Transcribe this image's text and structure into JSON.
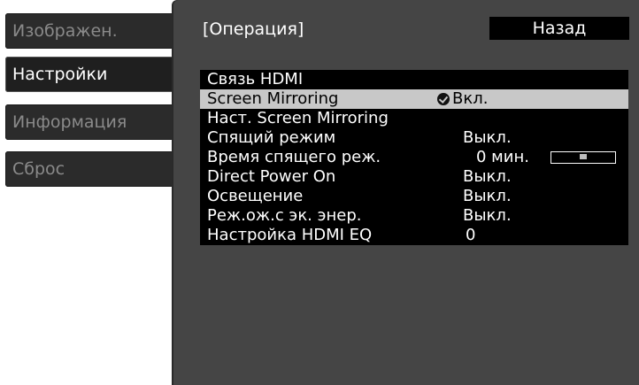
{
  "sidebar": {
    "items": [
      {
        "label": "Изображен."
      },
      {
        "label": "Настройки"
      },
      {
        "label": "Информация"
      },
      {
        "label": "Сброс"
      }
    ]
  },
  "header": {
    "title": "[Операция]",
    "back_label": "Назад"
  },
  "menu": {
    "rows": [
      {
        "label": "Связь HDMI",
        "value": ""
      },
      {
        "label": "Screen Mirroring",
        "value": "Вкл."
      },
      {
        "label": "Наст. Screen Mirroring",
        "value": ""
      },
      {
        "label": "Спящий режим",
        "value": "Выкл."
      },
      {
        "label": "Время спящего реж.",
        "value": "0 мин."
      },
      {
        "label": "Direct Power On",
        "value": "Выкл."
      },
      {
        "label": "Освещение",
        "value": "Выкл."
      },
      {
        "label": "Реж.ож.с эк. энер.",
        "value": "Выкл."
      },
      {
        "label": "Настройка HDMI EQ",
        "value": "0"
      }
    ],
    "sleep_time_slider_level": 0.5
  }
}
